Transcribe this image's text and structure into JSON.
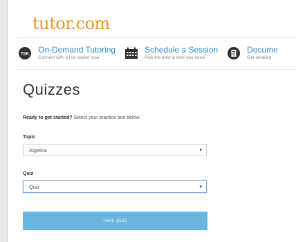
{
  "brand": {
    "logo_text": "tutor.com",
    "logo_color": "#e8952a"
  },
  "nav": {
    "items": [
      {
        "title": "On-Demand Tutoring",
        "subtitle": "Connect with a live expert now",
        "icon": "tutor-badge-icon",
        "icon_text": "TSK"
      },
      {
        "title": "Schedule a Session",
        "subtitle": "Pick the tutor & time you need",
        "icon": "calendar-icon"
      },
      {
        "title": "Docume",
        "subtitle": "Get detailed",
        "icon": "document-icon"
      }
    ],
    "accent": "#2d8bc9"
  },
  "page": {
    "title": "Quizzes",
    "intro_bold": "Ready to get started?",
    "intro_rest": " Select your practice test below."
  },
  "form": {
    "topic_label": "Topic",
    "topic_value": "Algebra",
    "quiz_label": "Quiz",
    "quiz_value": "Quiz",
    "submit_label": "TAKE QUIZ",
    "submit_color": "#6ab4e0"
  }
}
